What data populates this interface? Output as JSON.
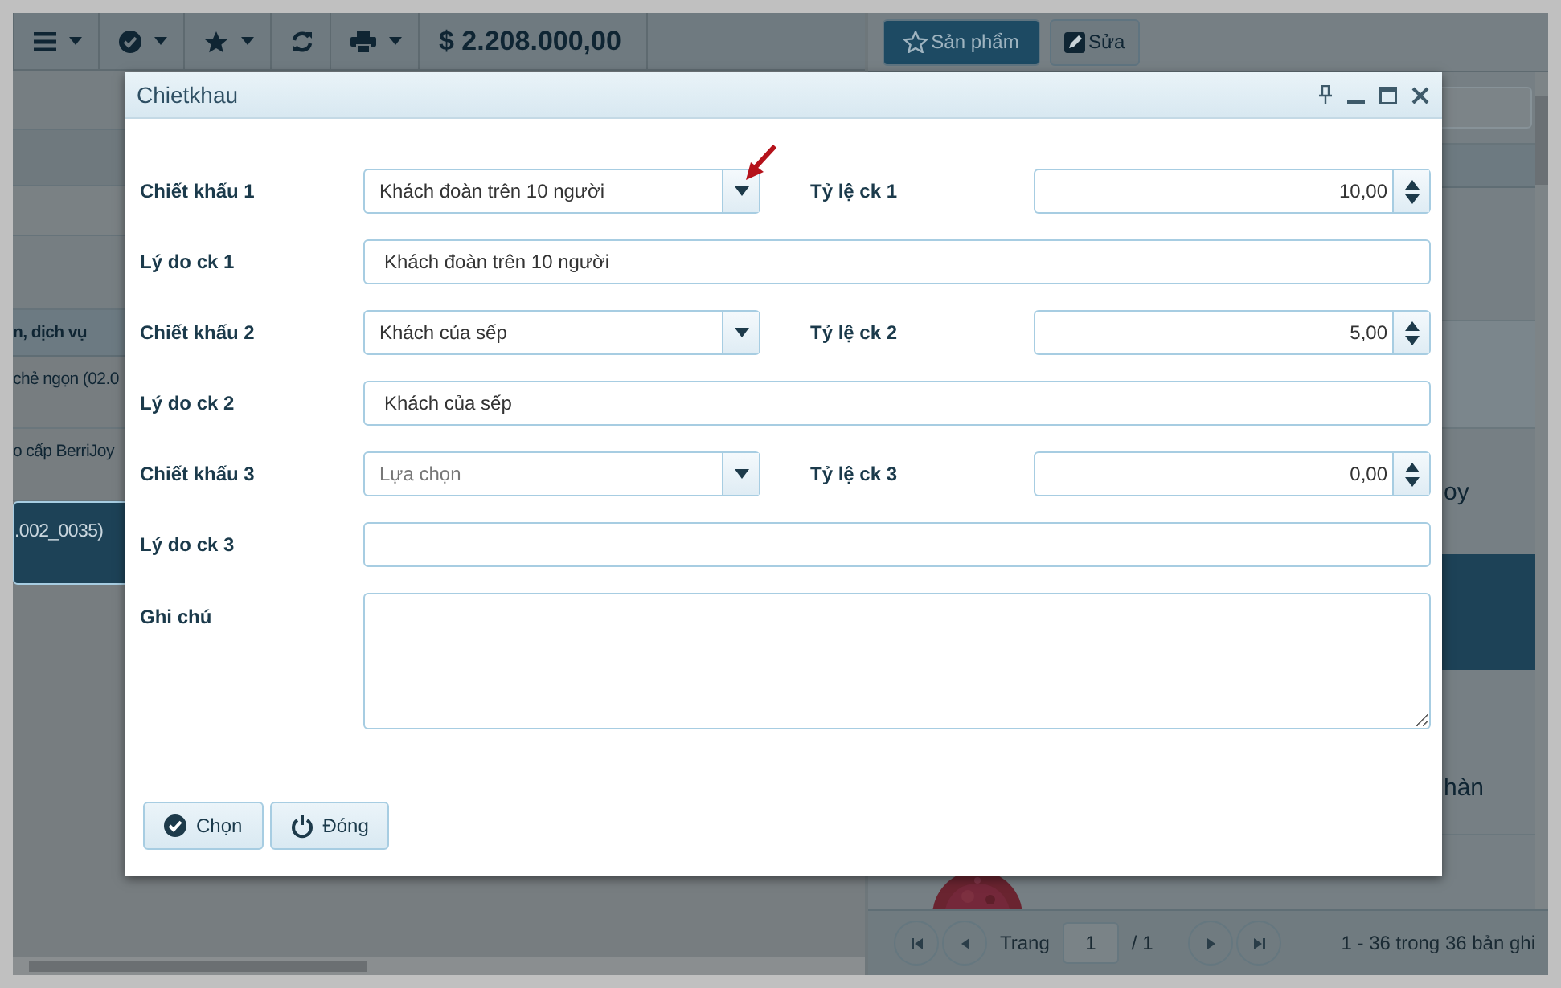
{
  "toolbar": {
    "total": "$ 2.208.000,00"
  },
  "right_toolbar": {
    "buttons": [
      {
        "label": "Sản phẩm",
        "selected": true
      },
      {
        "label": "Sửa",
        "selected": false
      }
    ]
  },
  "list": {
    "header": "n, dịch vụ",
    "rows": [
      {
        "text": "chẻ ngọn (02.0",
        "selected": false
      },
      {
        "text": "o cấp BerriJoy",
        "selected": false
      },
      {
        "text": ".002_0035)",
        "selected": true
      }
    ]
  },
  "detail": {
    "texts": [
      "oy",
      "hàn"
    ]
  },
  "pagination": {
    "label": "Trang",
    "page": "1",
    "pages": "/ 1",
    "summary": "1 - 36 trong 36 bản ghi"
  },
  "dialog": {
    "title": "Chietkhau",
    "rows": [
      {
        "kind": "select_rate",
        "label": "Chiết khấu 1",
        "value": "Khách đoàn trên 10 người",
        "rate_label": "Tỷ lệ ck 1",
        "rate": "10,00"
      },
      {
        "kind": "text",
        "label": "Lý do ck 1",
        "value": "Khách đoàn trên 10 người"
      },
      {
        "kind": "select_rate",
        "label": "Chiết khấu 2",
        "value": "Khách của sếp",
        "rate_label": "Tỷ lệ ck 2",
        "rate": "5,00"
      },
      {
        "kind": "text",
        "label": "Lý do ck 2",
        "value": "Khách của sếp"
      },
      {
        "kind": "select_rate",
        "label": "Chiết khấu 3",
        "placeholder": "Lựa chọn",
        "rate_label": "Tỷ lệ ck 3",
        "rate": "0,00"
      },
      {
        "kind": "text",
        "label": "Lý do ck 3"
      },
      {
        "kind": "textarea",
        "label": "Ghi chú"
      }
    ],
    "buttons": [
      {
        "label": "Chọn"
      },
      {
        "label": "Đóng"
      }
    ]
  }
}
